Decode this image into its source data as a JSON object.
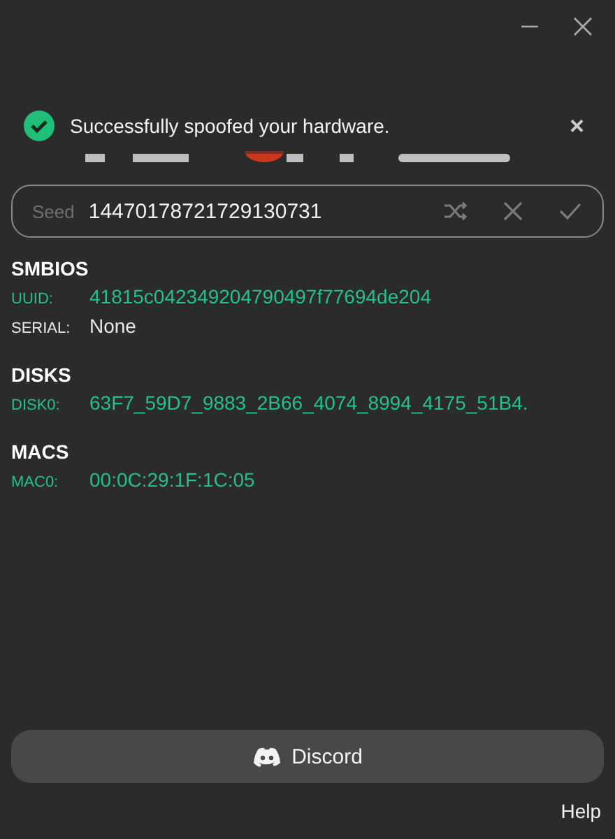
{
  "toast": {
    "message": "Successfully spoofed your hardware.",
    "close": "×"
  },
  "seed": {
    "label": "Seed",
    "value": "14470178721729130731"
  },
  "sections": [
    {
      "title": "SMBIOS",
      "rows": [
        {
          "label": "UUID:",
          "value": "41815c042349204790497f77694de204",
          "spoofed": true
        },
        {
          "label": "SERIAL:",
          "value": "None",
          "spoofed": false
        }
      ]
    },
    {
      "title": "DISKS",
      "rows": [
        {
          "label": "DISK0:",
          "value": "63F7_59D7_9883_2B66_4074_8994_4175_51B4.",
          "spoofed": true
        }
      ]
    },
    {
      "title": "MACS",
      "rows": [
        {
          "label": "MAC0:",
          "value": "00:0C:29:1F:1C:05",
          "spoofed": true
        }
      ]
    }
  ],
  "discord_button": "Discord",
  "help_link": "Help"
}
